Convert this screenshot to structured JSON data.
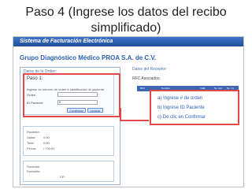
{
  "slide": {
    "title_line_1": "Paso 4 (Ingrese los datos del recibo",
    "title_line_2": "simplificado)"
  },
  "app": {
    "header_title": "Sistema de Facturación Electrónica",
    "company_name": "Grupo Diagnóstico Médico PROA S.A. de C.V."
  },
  "left_panel": {
    "panel_title": "Datos de la Orden:",
    "step_title": "Paso 1:",
    "step_description": "Ingrese su número de orden e identificador de paciente.",
    "fields": {
      "orden_label": "Orden",
      "orden_value": "",
      "paciente_label": "ID Paciente",
      "paciente_value": "0"
    },
    "buttons": {
      "confirm": "Confirmar",
      "clear": "Limpiar"
    },
    "patient_info": {
      "paciente_label": "Paciente:",
      "paciente_value": "",
      "saldo_label": "Saldo:",
      "saldo_value": "0.00",
      "total_label": "Total:",
      "total_value": "0.00",
      "fecha_label": "Fecha:",
      "fecha_value": "/ / 00:00"
    },
    "bottom_box": {
      "sucursal_label": "Sucursal:",
      "domicilio_label": "Domicilio:",
      "cp_label": "CP:"
    }
  },
  "right_panel": {
    "title": "Datos del Receptor:",
    "rfc_label": "RFC Asociados:",
    "table_headers": [
      "RFC",
      "Nombre",
      "Calle",
      "No. Ext",
      "No. Int"
    ]
  },
  "callout": {
    "items": [
      "a) Ingrese # de orden",
      "b) Ingrese ID Paciente",
      "c) De clic en Confirmar"
    ]
  }
}
